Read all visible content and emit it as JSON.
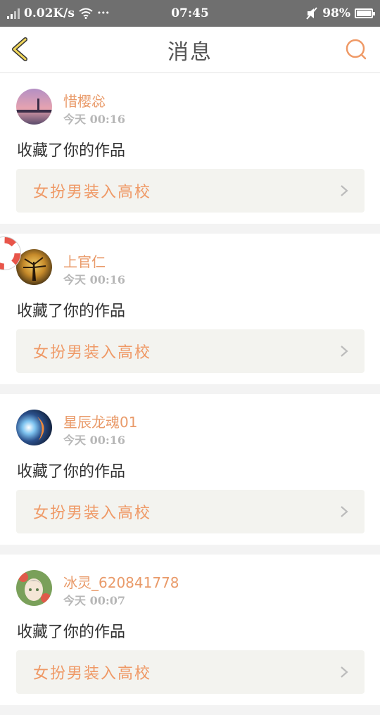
{
  "status_bar": {
    "speed": "0.02K/s",
    "dots": "···",
    "time": "07:45",
    "battery": "98%",
    "battery_level": 0.98
  },
  "header": {
    "title": "消息",
    "accent_color": "#e99a69"
  },
  "messages": [
    {
      "username": "惜樱惢",
      "time": "今天 00:16",
      "action": "收藏了你的作品",
      "work_title": "女扮男装入高校"
    },
    {
      "username": "上官仁",
      "time": "今天 00:16",
      "action": "收藏了你的作品",
      "work_title": "女扮男装入高校"
    },
    {
      "username": "星辰龙魂01",
      "time": "今天 00:16",
      "action": "收藏了你的作品",
      "work_title": "女扮男装入高校"
    },
    {
      "username": "冰灵_620841778",
      "time": "今天 00:07",
      "action": "收藏了你的作品",
      "work_title": "女扮男装入高校"
    }
  ],
  "icons": {
    "back": "chevron-left-icon",
    "search": "search-icon",
    "arrow": "chevron-right-icon",
    "float": "lifebuoy-icon"
  }
}
